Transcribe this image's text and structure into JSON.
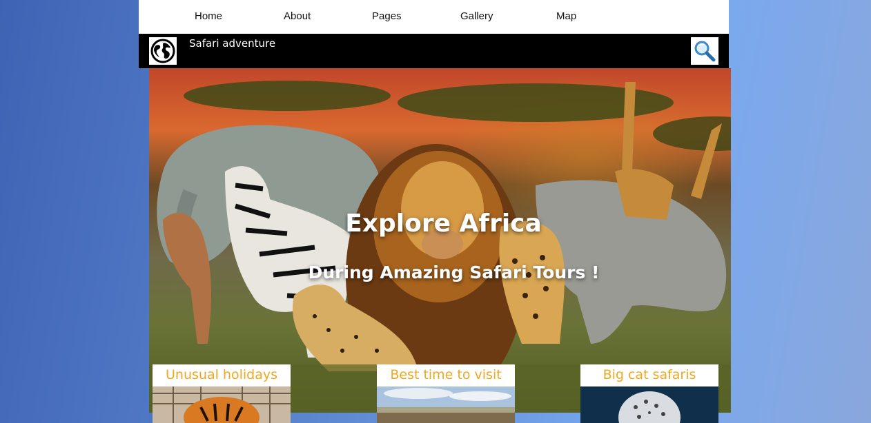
{
  "nav": {
    "items": [
      "Home",
      "About",
      "Pages",
      "Gallery",
      "Map"
    ]
  },
  "header": {
    "site_title": "Safari adventure",
    "logo_icon": "globe-icon",
    "search_icon": "magnifier-icon"
  },
  "hero": {
    "headline": "Explore Africa",
    "subheadline": "During Amazing Safari Tours !"
  },
  "cards": [
    {
      "title": "Unusual holidays",
      "image": "tiger-image"
    },
    {
      "title": "Best time to visit",
      "image": "savanna-image"
    },
    {
      "title": "Big cat safaris",
      "image": "snow-leopard-image"
    }
  ],
  "colors": {
    "card_title": "#f0a820",
    "topbar": "#000000",
    "nav": "#ffffff"
  }
}
